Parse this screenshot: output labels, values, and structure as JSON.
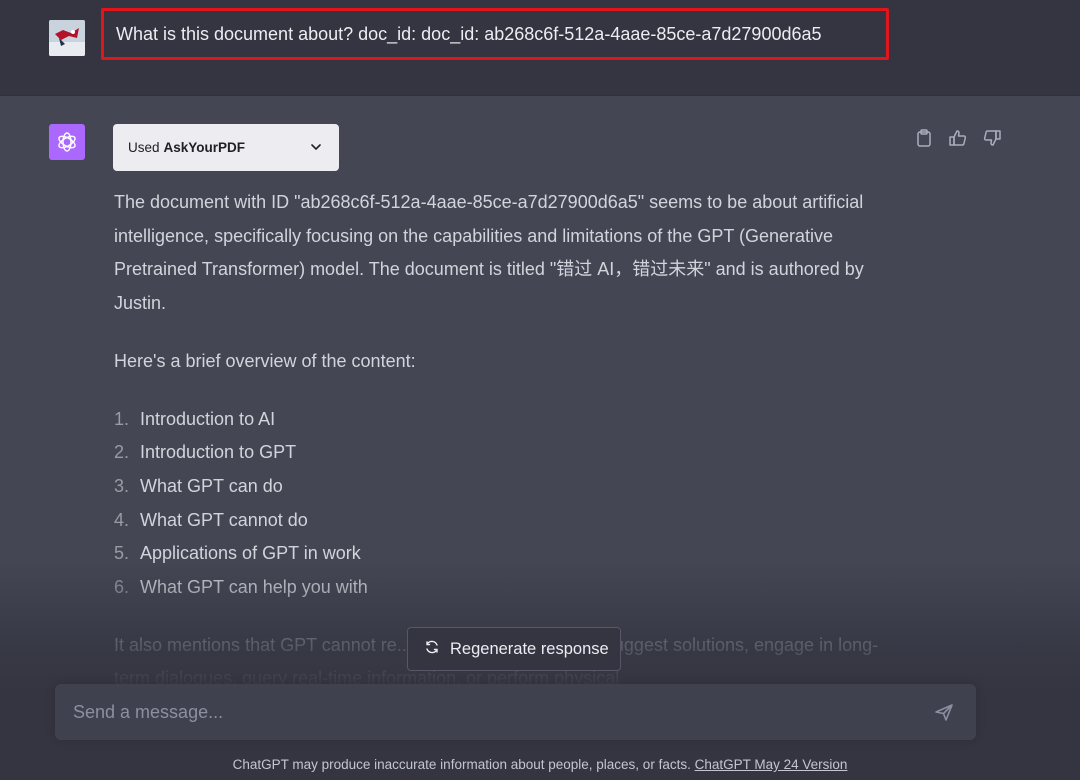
{
  "user_message": {
    "text": "What is this document about? doc_id: doc_id: ab268c6f-512a-4aae-85ce-a7d27900d6a5"
  },
  "plugin": {
    "prefix": "Used",
    "name": "AskYourPDF"
  },
  "actions": [
    "copy-icon",
    "thumbs-up-icon",
    "thumbs-down-icon"
  ],
  "response": {
    "intro": "The document with ID \"ab268c6f-512a-4aae-85ce-a7d27900d6a5\" seems to be about artificial intelligence, specifically focusing on the capabilities and limitations of the GPT (Generative Pretrained Transformer) model. The document is titled \"错过 AI，错过未来\" and is authored by Justin.",
    "overview_heading": "Here's a brief overview of the content:",
    "items": [
      {
        "num": "1.",
        "text": "Introduction to AI"
      },
      {
        "num": "2.",
        "text": "Introduction to GPT"
      },
      {
        "num": "3.",
        "text": "What GPT can do"
      },
      {
        "num": "4.",
        "text": "What GPT cannot do"
      },
      {
        "num": "5.",
        "text": "Applications of GPT in work"
      },
      {
        "num": "6.",
        "text": "What GPT can help you with"
      }
    ],
    "closing": "It also mentions that GPT cannot re... ...unication, proactively suggest solutions, engage in long-term dialogues, query real-time information, or perform physical"
  },
  "regenerate": {
    "label": "Regenerate response"
  },
  "composer": {
    "placeholder": "Send a message..."
  },
  "footer": {
    "disclaimer": "ChatGPT may produce inaccurate information about people, places, or facts.",
    "version_link": "ChatGPT May 24 Version"
  },
  "colors": {
    "highlight_border": "#e0161c",
    "gpt_avatar": "#ab68ff"
  }
}
